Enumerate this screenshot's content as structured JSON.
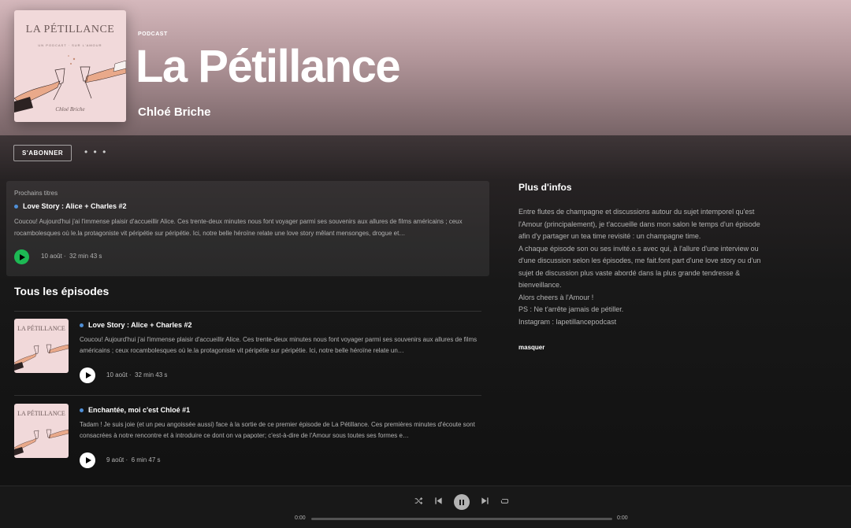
{
  "header": {
    "cover": {
      "title": "LA PÉTILLANCE",
      "subtitle": "UN PODCAST · SUR L'AMOUR",
      "signature": "Chloé Briche"
    },
    "type_label": "PODCAST",
    "title": "La Pétillance",
    "author": "Chloé Briche"
  },
  "actions": {
    "subscribe_label": "S'ABONNER",
    "more_label": "• • •"
  },
  "up_next": {
    "label": "Prochains titres",
    "title": "Love Story : Alice + Charles #2",
    "description": "Coucou! Aujourd'hui j'ai l'immense plaisir d'accueillir Alice. Ces trente-deux minutes nous font voyager parmi ses souvenirs aux allures de films américains ; ceux rocambolesques où le.la protagoniste vit péripétie sur péripétie. Ici, notre belle héroïne relate une love story mêlant mensonges, drogue et…",
    "date": "10 août",
    "duration": "32 min 43 s"
  },
  "all_episodes": {
    "title": "Tous les épisodes",
    "items": [
      {
        "thumb_title": "LA PÉTILLANCE",
        "title": "Love Story : Alice + Charles #2",
        "description": "Coucou! Aujourd'hui j'ai l'immense plaisir d'accueillir Alice. Ces trente-deux minutes nous font voyager parmi ses souvenirs aux allures de films américains ; ceux rocambolesques où le.la protagoniste vit péripétie sur péripétie. Ici, notre belle héroïne relate un…",
        "date": "10 août",
        "duration": "32 min 43 s"
      },
      {
        "thumb_title": "LA PÉTILLANCE",
        "title": "Enchantée, moi c'est Chloé #1",
        "description": "Tadam ! Je suis joie (et un peu angoissée aussi) face à la sortie de ce premier épisode de La Pétillance. Ces premières minutes d'écoute sont consacrées à notre rencontre et à introduire ce dont on va papoter; c'est-à-dire de l'Amour sous toutes ses formes e…",
        "date": "9 août",
        "duration": "6 min 47 s"
      }
    ]
  },
  "info": {
    "title": "Plus d'infos",
    "paragraphs": [
      "Entre flutes de champagne et discussions autour du sujet intemporel qu'est l'Amour (principalement), je t'accueille dans mon salon le temps d'un épisode afin d'y partager un tea time revisité : un champagne time.",
      "A chaque épisode son ou ses invité.e.s avec qui, à l'allure d'une interview ou d'une discussion selon les épisodes, me fait.font part d'une love story ou d'un sujet de discussion plus vaste abordé dans la plus grande tendresse & bienveillance.",
      "Alors cheers à l'Amour !",
      "PS : Ne t'arrête jamais de pétiller.",
      "Instagram : lapetillancepodcast"
    ],
    "hide_label": "masquer"
  },
  "player": {
    "elapsed": "0:00",
    "total": "0:00",
    "progress": 0
  },
  "colors": {
    "accent": "#1db954",
    "dot": "#4f8fd6",
    "header_bg": "#d5b8bc",
    "cover_bg": "#f1d9da"
  }
}
